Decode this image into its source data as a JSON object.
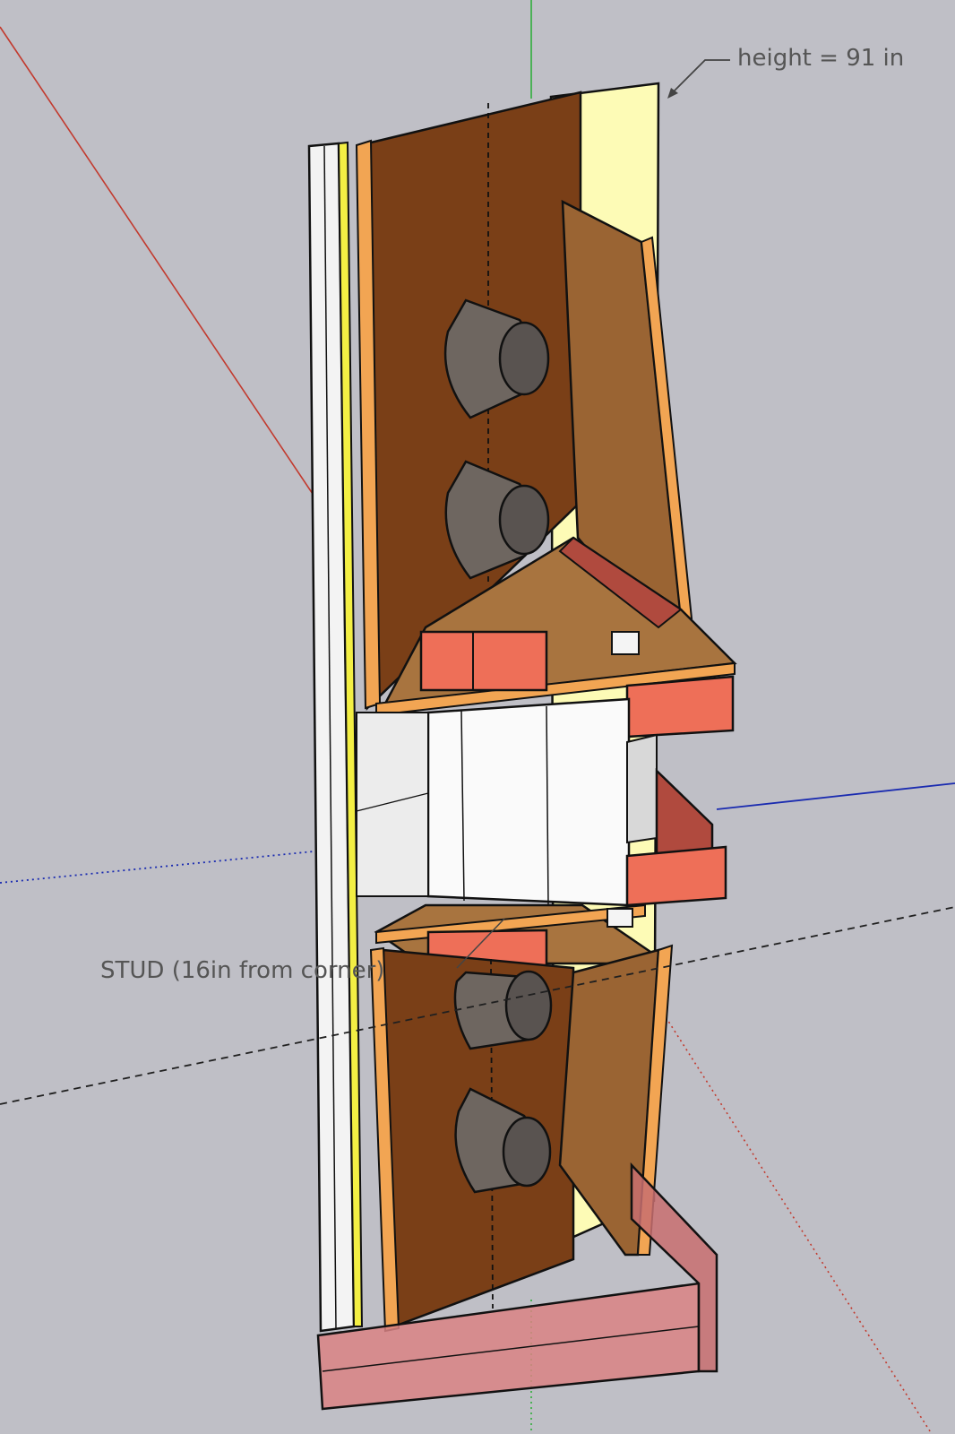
{
  "annotations": {
    "height_label": "height = 91 in",
    "stud_label": "STUD (16in from corner)"
  },
  "colors": {
    "background": "#bfbfc6",
    "panel_dark": "#7a3f17",
    "panel_edge": "#f2a553",
    "panel_mid": "#9a6433",
    "panel_light": "#a8743f",
    "block_salmon": "#ee6f58",
    "block_dark": "#b04a3e",
    "light_yellow": "#fdfbb6",
    "frame_pink": "#d98384",
    "cone_gray": "#6e6660",
    "cone_face": "#595350",
    "axis_red": "#c23a2e",
    "axis_green": "#2fae3b",
    "axis_blue": "#1a2bb0",
    "guide_black": "#202020"
  },
  "icons": {
    "red_axis": "red-axis-line",
    "green_axis": "green-axis-line",
    "blue_axis": "blue-axis-line"
  }
}
